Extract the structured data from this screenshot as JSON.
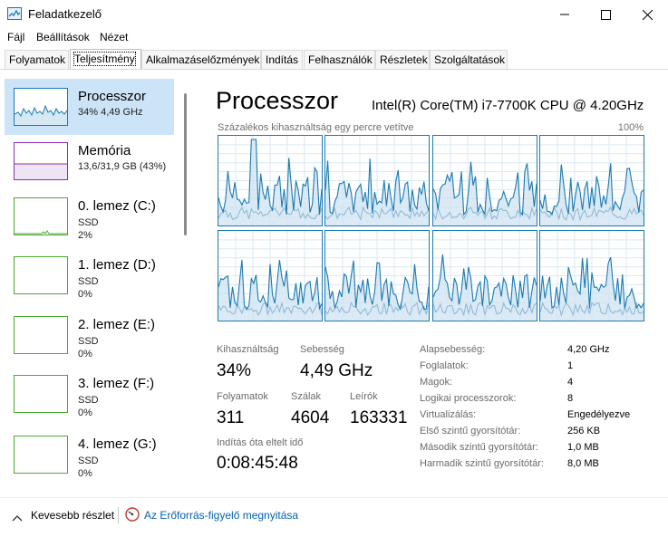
{
  "window": {
    "title": "Feladatkezelő",
    "icons": {
      "app": "task-manager-icon",
      "minimize": "minimize-icon",
      "maximize": "maximize-icon",
      "close": "close-icon"
    }
  },
  "menu": {
    "items": [
      "Fájl",
      "Beállítások",
      "Nézet"
    ]
  },
  "tabs": {
    "items": [
      "Folyamatok",
      "Teljesítmény",
      "Alkalmazáselőzmények",
      "Indítás",
      "Felhasználók",
      "Részletek",
      "Szolgáltatások"
    ],
    "selected": "Teljesítmény"
  },
  "sidebar": {
    "items": [
      {
        "name": "Processzor",
        "sub1": "34%  4,49 GHz",
        "sub2": "",
        "color": "#1b7ab0",
        "selected": true
      },
      {
        "name": "Memória",
        "sub1": "13,6/31,9 GB (43%)",
        "sub2": "",
        "color": "#8b2db0",
        "selected": false
      },
      {
        "name": "0. lemez (C:)",
        "sub1": "SSD",
        "sub2": "2%",
        "color": "#4ca930",
        "selected": false
      },
      {
        "name": "1. lemez (D:)",
        "sub1": "SSD",
        "sub2": "0%",
        "color": "#4ca930",
        "selected": false
      },
      {
        "name": "2. lemez (E:)",
        "sub1": "SSD",
        "sub2": "0%",
        "color": "#4ca930",
        "selected": false
      },
      {
        "name": "3. lemez (F:)",
        "sub1": "SSD",
        "sub2": "0%",
        "color": "#4ca930",
        "selected": false
      },
      {
        "name": "4. lemez (G:)",
        "sub1": "SSD",
        "sub2": "0%",
        "color": "#4ca930",
        "selected": false
      }
    ]
  },
  "main": {
    "title": "Processzor",
    "cpu_model": "Intel(R) Core(TM) i7-7700K CPU @ 4.20GHz",
    "graph_caption": "Százalékos kihasználtság egy percre vetítve",
    "graph_max": "100%",
    "graph_color": "#1b7ab0",
    "stats": {
      "utilization_label": "Kihasználtság",
      "utilization_value": "34%",
      "speed_label": "Sebesség",
      "speed_value": "4,49 GHz",
      "processes_label": "Folyamatok",
      "processes_value": "311",
      "threads_label": "Szálak",
      "threads_value": "4604",
      "handles_label": "Leírók",
      "handles_value": "163331",
      "uptime_label": "Indítás óta eltelt idő",
      "uptime_value": "0:08:45:48"
    },
    "specs": [
      {
        "label": "Alapsebesség:",
        "value": "4,20 GHz"
      },
      {
        "label": "Foglalatok:",
        "value": "1"
      },
      {
        "label": "Magok:",
        "value": "4"
      },
      {
        "label": "Logikai processzorok:",
        "value": "8"
      },
      {
        "label": "Virtualizálás:",
        "value": "Engedélyezve"
      },
      {
        "label": "Első szintű gyorsítótár:",
        "value": "256 KB"
      },
      {
        "label": "Második szintű gyorsítótár:",
        "value": "1,0 MB"
      },
      {
        "label": "Harmadik szintű gyorsítótár:",
        "value": "8,0 MB"
      }
    ]
  },
  "footer": {
    "less_details": "Kevesebb részlet",
    "resource_monitor": "Az Erőforrás-figyelő megnyitása"
  }
}
